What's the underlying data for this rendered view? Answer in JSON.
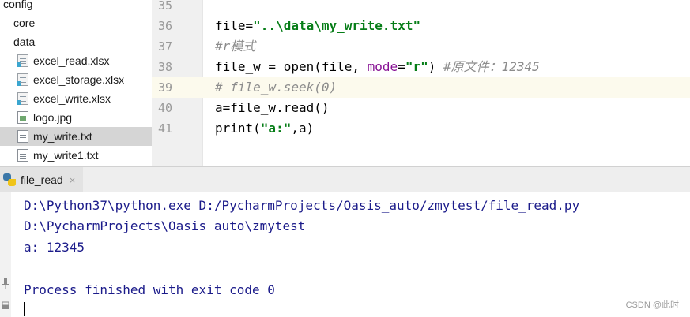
{
  "project_tree": {
    "items": [
      {
        "label": "config",
        "icon": "folder-icon"
      },
      {
        "label": "core",
        "icon": "folder-icon"
      },
      {
        "label": "data",
        "icon": "folder-icon"
      },
      {
        "label": "excel_read.xlsx",
        "icon": "excel-file-icon"
      },
      {
        "label": "excel_storage.xlsx",
        "icon": "excel-file-icon"
      },
      {
        "label": "excel_write.xlsx",
        "icon": "excel-file-icon"
      },
      {
        "label": "logo.jpg",
        "icon": "image-file-icon"
      },
      {
        "label": "my_write.txt",
        "icon": "text-file-icon"
      },
      {
        "label": "my_write1.txt",
        "icon": "text-file-icon"
      }
    ],
    "selected": "my_write.txt"
  },
  "editor": {
    "lines": [
      {
        "number": "35"
      },
      {
        "number": "36",
        "parts": {
          "a": "file=",
          "b": "\"..\\data\\my_write.txt\""
        }
      },
      {
        "number": "37",
        "parts": {
          "a": "#r模式"
        }
      },
      {
        "number": "38",
        "parts": {
          "a": "file_w = open(file, ",
          "b": "mode",
          "c": "=",
          "d": "\"r\"",
          "e": ") ",
          "f": "#原文件：12345"
        }
      },
      {
        "number": "39",
        "parts": {
          "a": "# file_w.seek(0)"
        }
      },
      {
        "number": "40",
        "parts": {
          "a": "a=file_w.read()"
        }
      },
      {
        "number": "41",
        "parts": {
          "a": "print(",
          "b": "\"a:\"",
          "c": ",a)"
        }
      }
    ],
    "current_line": "39"
  },
  "run_panel": {
    "tab_label": "file_read",
    "tab_close": "×",
    "console": [
      "D:\\Python37\\python.exe D:/PycharmProjects/Oasis_auto/zmytest/file_read.py",
      "D:\\PycharmProjects\\Oasis_auto\\zmytest",
      "a: 12345",
      "",
      "Process finished with exit code 0"
    ]
  },
  "watermark": "CSDN @此时",
  "colors": {
    "string": "#067d17",
    "keyword_arg": "#871094",
    "comment": "#8c8c8c",
    "console_text": "#1b1b8a",
    "selection": "#d5d5d5",
    "current_line": "#fcfaed"
  }
}
